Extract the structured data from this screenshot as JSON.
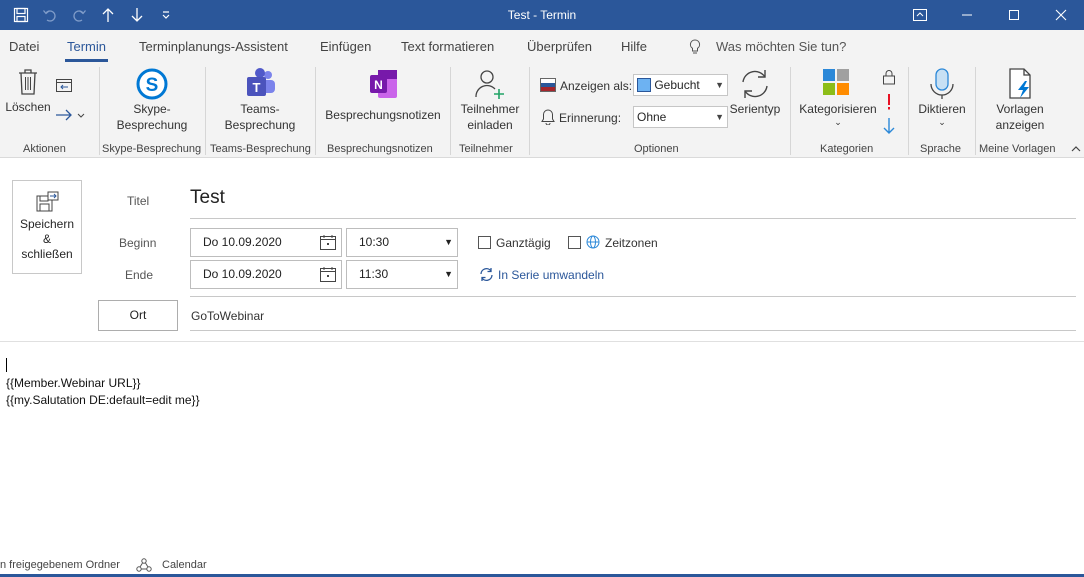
{
  "window": {
    "title": "Test  -  Termin"
  },
  "quick_access": {
    "icons": [
      "save-icon",
      "undo-icon",
      "redo-icon",
      "arrow-up-icon",
      "arrow-down-icon",
      "customize-icon"
    ]
  },
  "tabs": [
    {
      "label": "Datei"
    },
    {
      "label": "Termin",
      "active": true
    },
    {
      "label": "Terminplanungs-Assistent"
    },
    {
      "label": "Einfügen"
    },
    {
      "label": "Text formatieren"
    },
    {
      "label": "Überprüfen"
    },
    {
      "label": "Hilfe"
    }
  ],
  "tell_me": "Was möchten Sie tun?",
  "ribbon": {
    "aktionen": {
      "delete_label": "Löschen",
      "group_label": "Aktionen"
    },
    "skype": {
      "button_line1": "Skype-",
      "button_line2": "Besprechung",
      "group_label": "Skype-Besprechung"
    },
    "teams": {
      "button_line1": "Teams-",
      "button_line2": "Besprechung",
      "group_label": "Teams-Besprechung"
    },
    "notes": {
      "button_label": "Besprechungsnotizen",
      "group_label": "Besprechungsnotizen"
    },
    "attendees": {
      "button_line1": "Teilnehmer",
      "button_line2": "einladen",
      "group_label": "Teilnehmer"
    },
    "options": {
      "show_as_label": "Anzeigen als:",
      "show_as_value": "Gebucht",
      "reminder_label": "Erinnerung:",
      "reminder_value": "Ohne",
      "recurrence_label": "Serientyp",
      "group_label": "Optionen"
    },
    "categories": {
      "button_label": "Kategorisieren",
      "group_label": "Kategorien"
    },
    "speech": {
      "button_label": "Diktieren",
      "group_label": "Sprache"
    },
    "templates": {
      "button_line1": "Vorlagen",
      "button_line2": "anzeigen",
      "group_label": "Meine Vorlagen"
    }
  },
  "form": {
    "save_line1": "Speichern",
    "save_line2": "&",
    "save_line3": "schließen",
    "title_label": "Titel",
    "title_value": "Test",
    "start_label": "Beginn",
    "start_date": "Do 10.09.2020",
    "start_time": "10:30",
    "end_label": "Ende",
    "end_date": "Do 10.09.2020",
    "end_time": "11:30",
    "all_day_label": "Ganztägig",
    "time_zones_label": "Zeitzonen",
    "recurring_label": "In Serie umwandeln",
    "location_button": "Ort",
    "location_value": "GoToWebinar"
  },
  "body": {
    "lines": [
      "{{Member.Webinar URL}}",
      "{{my.Salutation DE:default=edit me}}"
    ]
  },
  "status": {
    "folder_text": "n freigegebenem Ordner",
    "calendar_text": "Calendar"
  },
  "colors": {
    "accent": "#2b579a",
    "ribbon_bg": "#f3f3f3"
  }
}
